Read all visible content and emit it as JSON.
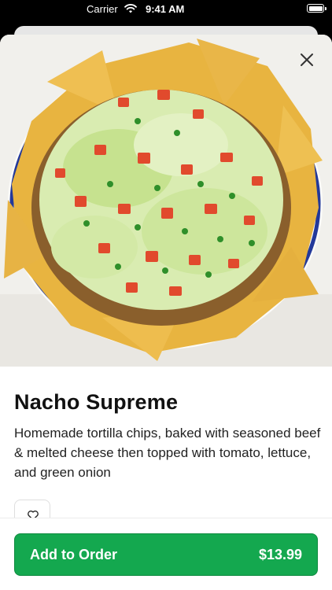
{
  "status_bar": {
    "carrier": "Carrier",
    "time": "9:41 AM",
    "wifi_icon": "wifi-icon",
    "battery_icon": "battery-icon",
    "battery_level": 1.0
  },
  "hero": {
    "image_icon": "nacho-photo"
  },
  "item": {
    "title": "Nacho Supreme",
    "description": "Homemade tortilla chips, baked with seasoned beef & melted cheese then topped with tomato, lettuce, and green onion"
  },
  "actions": {
    "close_icon": "close-icon",
    "favorite_icon": "heart-icon",
    "add_label": "Add to Order",
    "price": "$13.99"
  },
  "colors": {
    "accent": "#14a84f",
    "text": "#111111"
  }
}
